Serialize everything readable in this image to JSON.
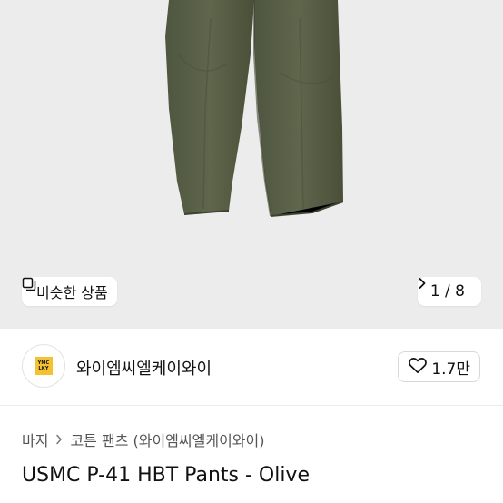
{
  "gallery": {
    "similar_label": "비슷한 상품",
    "pager_text": "1 / 8",
    "current_image": 1,
    "total_images": 8,
    "icons": {
      "similar": "similar-products-icon",
      "next": "chevron-right-icon"
    }
  },
  "seller": {
    "name": "와이엠씨엘케이와이",
    "logo_lines": [
      "YMC",
      "LKY"
    ],
    "like_count": "1.7만",
    "colors": {
      "logo_bg": "#f2c230"
    },
    "icons": {
      "like": "heart-icon"
    }
  },
  "breadcrumb": {
    "items": [
      "바지",
      "코튼 팬츠 (와이엠씨엘케이와이)"
    ],
    "separator_icon": "chevron-right-icon"
  },
  "product": {
    "title": "USMC P-41 HBT Pants - Olive",
    "colors": {
      "garment": "#5b6249"
    }
  }
}
